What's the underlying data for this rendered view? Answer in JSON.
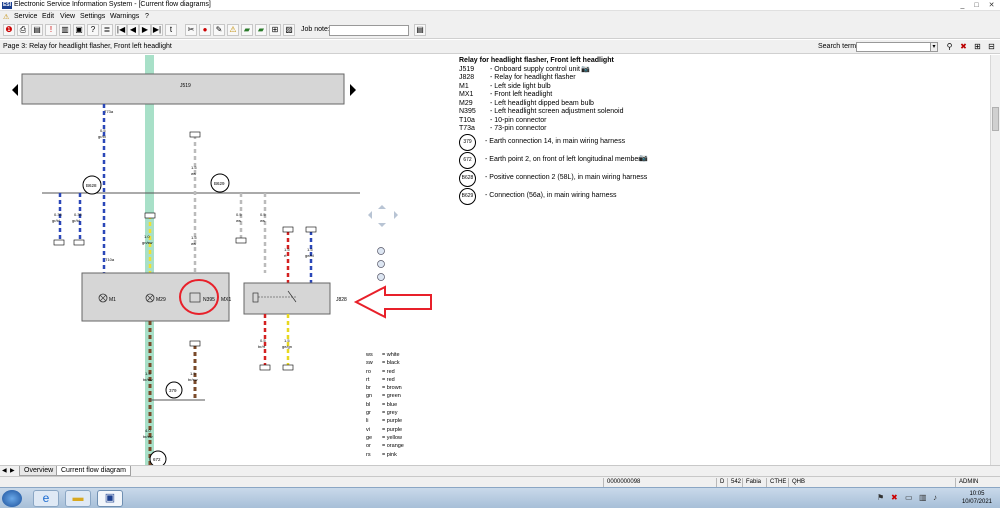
{
  "window": {
    "title": "Electronic Service Information System - [Current flow diagrams]",
    "logo": "ESI",
    "controls": [
      "_",
      "□",
      "✕"
    ]
  },
  "menu": {
    "items": [
      "Service",
      "Edit",
      "View",
      "Settings",
      "Warnings",
      "?"
    ]
  },
  "toolbar": {
    "job_note_label": "Job note:",
    "job_note_value": ""
  },
  "page": {
    "title": "Page 3: Relay for headlight flasher, Front left headlight",
    "search_label": "Search terms:",
    "search_value": ""
  },
  "legend": {
    "title": "Relay for headlight flasher, Front left headlight",
    "components": [
      {
        "code": "J519",
        "desc": "-  Onboard supply control unit"
      },
      {
        "code": "J828",
        "desc": "-  Relay for headlight flasher"
      },
      {
        "code": "M1",
        "desc": "-  Left side light bulb"
      },
      {
        "code": "MX1",
        "desc": "-  Front left headlight"
      },
      {
        "code": "M29",
        "desc": "-  Left headlight dipped beam bulb"
      },
      {
        "code": "N395",
        "desc": "-  Left headlight screen adjustment solenoid"
      },
      {
        "code": "T10a",
        "desc": "-  10-pin connector"
      },
      {
        "code": "T73a",
        "desc": "-  73-pin connector"
      }
    ],
    "connections": [
      {
        "code": "379",
        "desc": "-  Earth connection 14, in main wiring harness"
      },
      {
        "code": "672",
        "desc": "-  Earth point 2, on front of left longitudinal member"
      },
      {
        "code": "B628",
        "desc": "-  Positive connection 2 (58L), in main wiring harness"
      },
      {
        "code": "B629",
        "desc": "-  Connection (56a), in main wiring harness"
      }
    ]
  },
  "diagram": {
    "labels": {
      "j519": "J519",
      "j828": "J828",
      "mx1": "MX1",
      "m1": "M1",
      "m29": "M29",
      "n395": "N395",
      "b628": "B628",
      "b629": "B629",
      "e379": "379",
      "e672": "672",
      "t73a": "T73a",
      "t10a": "T10a"
    },
    "wires": [
      {
        "size": "0.5",
        "color": "gr/bl"
      },
      {
        "size": "0.35",
        "color": "gr/bl"
      },
      {
        "size": "0.35",
        "color": "gr/bl"
      },
      {
        "size": "1.0",
        "color": "gn/sw"
      },
      {
        "size": "1.5",
        "color": "ws"
      },
      {
        "size": "1.5",
        "color": "ws"
      },
      {
        "size": "0.5",
        "color": "ws"
      },
      {
        "size": "0.5",
        "color": "ws"
      },
      {
        "size": "1.5",
        "color": "rt"
      },
      {
        "size": "1.5",
        "color": "ge/bl"
      },
      {
        "size": "0.5",
        "color": "br/rt"
      },
      {
        "size": "1.5",
        "color": "ge/gn"
      },
      {
        "size": "1.5",
        "color": "br/sw"
      },
      {
        "size": "1.5",
        "color": "br/sw"
      },
      {
        "size": "4.0",
        "color": "br/sw"
      }
    ],
    "color_key": [
      {
        "k": "ws",
        "v": "= white"
      },
      {
        "k": "sw",
        "v": "= black"
      },
      {
        "k": "ro",
        "v": "= red"
      },
      {
        "k": "rt",
        "v": "= red"
      },
      {
        "k": "br",
        "v": "= brown"
      },
      {
        "k": "gn",
        "v": "= green"
      },
      {
        "k": "bl",
        "v": "= blue"
      },
      {
        "k": "gr",
        "v": "= grey"
      },
      {
        "k": "li",
        "v": "= purple"
      },
      {
        "k": "vi",
        "v": "= purple"
      },
      {
        "k": "ge",
        "v": "= yellow"
      },
      {
        "k": "or",
        "v": "= orange"
      },
      {
        "k": "rs",
        "v": "= pink"
      }
    ]
  },
  "tabs": [
    "Overview",
    "Current flow diagram"
  ],
  "status": {
    "id": "0000000098",
    "flag": "D",
    "f1": "542",
    "f2": "Fabia",
    "f3": "CTHE",
    "f4": "QHB",
    "user": "ADMIN"
  },
  "taskbar": {
    "time": "10:05",
    "date": "10/07/2021"
  },
  "colors": {
    "highlight_red": "#e8202a",
    "accent_blue": "#1b3f8f",
    "wire_green": "#a8e0c8"
  }
}
